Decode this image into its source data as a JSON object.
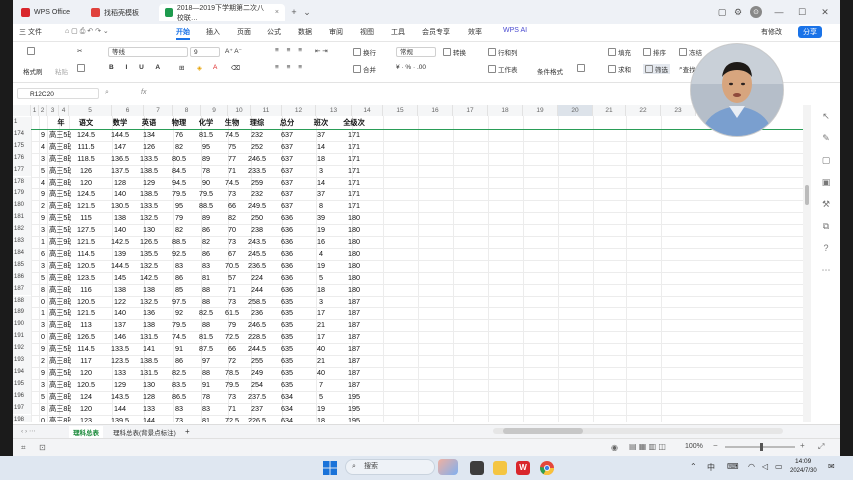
{
  "titlebar": {
    "tabs": [
      {
        "label": "WPS Office",
        "color": "#d9262c"
      },
      {
        "label": "找稻壳模板",
        "color": "#e0413c"
      },
      {
        "label": "2018—2019下学期第二次八校联…",
        "color": "#1e9b4e"
      }
    ],
    "add_tab": "+",
    "avatar_text": "⊙"
  },
  "menubar": {
    "file": "三 文件",
    "items": [
      "开始",
      "插入",
      "页面",
      "公式",
      "数据",
      "审阅",
      "视图",
      "工具",
      "会员专享",
      "效率",
      "WPS AI"
    ],
    "active": "开始",
    "modify_btn": "有修改",
    "share_btn": "分享"
  },
  "ribbon": {
    "format_painter": "格式刷",
    "paste": "粘贴",
    "font_name": "等线",
    "font_size": "9",
    "number_format": "常规",
    "wrap": "换行",
    "merge": "合并",
    "convert": "转换",
    "row_col": "行和列",
    "worksheet": "工作表",
    "cond_format": "条件格式",
    "fill": "填充",
    "sort": "排序",
    "freeze": "冻结",
    "sum": "求和",
    "filter": "筛选",
    "find": "查找"
  },
  "formula_bar": {
    "name_box": "R12C20",
    "fx": "fx"
  },
  "columns": [
    "1",
    "2",
    "3",
    "4",
    "5",
    "6",
    "7",
    "8",
    "9",
    "10",
    "11",
    "12",
    "13",
    "14",
    "15",
    "16",
    "17",
    "18",
    "19",
    "20",
    "21",
    "22",
    "23"
  ],
  "header_row": {
    "row_num": "1",
    "cells": [
      "年",
      "语文",
      "数学",
      "英语",
      "物理",
      "化学",
      "生物",
      "理综",
      "总分",
      "班次",
      "全级次"
    ]
  },
  "rows": [
    [
      "174",
      "9",
      "高三5班",
      "124.5",
      "144.5",
      "134",
      "76",
      "81.5",
      "74.5",
      "232",
      "637",
      "37",
      "171"
    ],
    [
      "175",
      "4",
      "高三8班",
      "111.5",
      "147",
      "126",
      "82",
      "95",
      "75",
      "252",
      "637",
      "14",
      "171"
    ],
    [
      "176",
      "3",
      "高三8班",
      "118.5",
      "136.5",
      "133.5",
      "80.5",
      "89",
      "77",
      "246.5",
      "637",
      "18",
      "171"
    ],
    [
      "177",
      "5",
      "高三5班",
      "126",
      "137.5",
      "138.5",
      "84.5",
      "78",
      "71",
      "233.5",
      "637",
      "3",
      "171"
    ],
    [
      "178",
      "4",
      "高三8班",
      "120",
      "128",
      "129",
      "94.5",
      "90",
      "74.5",
      "259",
      "637",
      "14",
      "171"
    ],
    [
      "179",
      "9",
      "高三5班",
      "124.5",
      "140",
      "138.5",
      "79.5",
      "79.5",
      "73",
      "232",
      "637",
      "37",
      "171"
    ],
    [
      "180",
      "2",
      "高三8班",
      "121.5",
      "130.5",
      "133.5",
      "95",
      "88.5",
      "66",
      "249.5",
      "637",
      "8",
      "171"
    ],
    [
      "181",
      "9",
      "高三5班",
      "115",
      "138",
      "132.5",
      "79",
      "89",
      "82",
      "250",
      "636",
      "39",
      "180"
    ],
    [
      "182",
      "3",
      "高三5班",
      "127.5",
      "140",
      "130",
      "82",
      "86",
      "70",
      "238",
      "636",
      "19",
      "180"
    ],
    [
      "183",
      "1",
      "高三9班",
      "121.5",
      "142.5",
      "126.5",
      "88.5",
      "82",
      "73",
      "243.5",
      "636",
      "16",
      "180"
    ],
    [
      "184",
      "6",
      "高三8班",
      "114.5",
      "139",
      "135.5",
      "92.5",
      "86",
      "67",
      "245.5",
      "636",
      "4",
      "180"
    ],
    [
      "185",
      "3",
      "高三8班",
      "120.5",
      "144.5",
      "132.5",
      "83",
      "83",
      "70.5",
      "236.5",
      "636",
      "19",
      "180"
    ],
    [
      "186",
      "5",
      "高三8班",
      "123.5",
      "145",
      "142.5",
      "86",
      "81",
      "57",
      "224",
      "636",
      "5",
      "180"
    ],
    [
      "187",
      "8",
      "高三8班",
      "116",
      "138",
      "138",
      "85",
      "88",
      "71",
      "244",
      "636",
      "18",
      "180"
    ],
    [
      "188",
      "0",
      "高三8班",
      "120.5",
      "122",
      "132.5",
      "97.5",
      "88",
      "73",
      "258.5",
      "635",
      "3",
      "187"
    ],
    [
      "189",
      "1",
      "高三5班",
      "121.5",
      "140",
      "136",
      "92",
      "82.5",
      "61.5",
      "236",
      "635",
      "17",
      "187"
    ],
    [
      "190",
      "3",
      "高三8班",
      "113",
      "137",
      "138",
      "79.5",
      "88",
      "79",
      "246.5",
      "635",
      "21",
      "187"
    ],
    [
      "191",
      "0",
      "高三8班",
      "126.5",
      "146",
      "131.5",
      "74.5",
      "81.5",
      "72.5",
      "228.5",
      "635",
      "17",
      "187"
    ],
    [
      "192",
      "9",
      "高三5班",
      "114.5",
      "133.5",
      "141",
      "91",
      "87.5",
      "66",
      "244.5",
      "635",
      "40",
      "187"
    ],
    [
      "193",
      "2",
      "高三8班",
      "117",
      "123.5",
      "138.5",
      "86",
      "97",
      "72",
      "255",
      "635",
      "21",
      "187"
    ],
    [
      "194",
      "9",
      "高三5班",
      "120",
      "133",
      "131.5",
      "82.5",
      "88",
      "78.5",
      "249",
      "635",
      "40",
      "187"
    ],
    [
      "195",
      "3",
      "高三8班",
      "120.5",
      "129",
      "130",
      "83.5",
      "91",
      "79.5",
      "254",
      "635",
      "7",
      "187"
    ],
    [
      "196",
      "5",
      "高三8班",
      "124",
      "143.5",
      "128",
      "86.5",
      "78",
      "73",
      "237.5",
      "634",
      "5",
      "195"
    ],
    [
      "197",
      "8",
      "高三8班",
      "120",
      "144",
      "133",
      "83",
      "83",
      "71",
      "237",
      "634",
      "19",
      "195"
    ],
    [
      "198",
      "0",
      "高三8班",
      "123",
      "139.5",
      "144",
      "73",
      "81",
      "72.5",
      "226.5",
      "634",
      "18",
      "195"
    ]
  ],
  "sheets": [
    "理科总表",
    "理科总表(背景点标注)"
  ],
  "active_sheet": "理科总表",
  "add_sheet": "+",
  "status": {
    "zoom": "100%"
  },
  "taskbar": {
    "search_placeholder": "搜索",
    "time": "14:09",
    "date": "2024/7/30",
    "ime": "中"
  }
}
